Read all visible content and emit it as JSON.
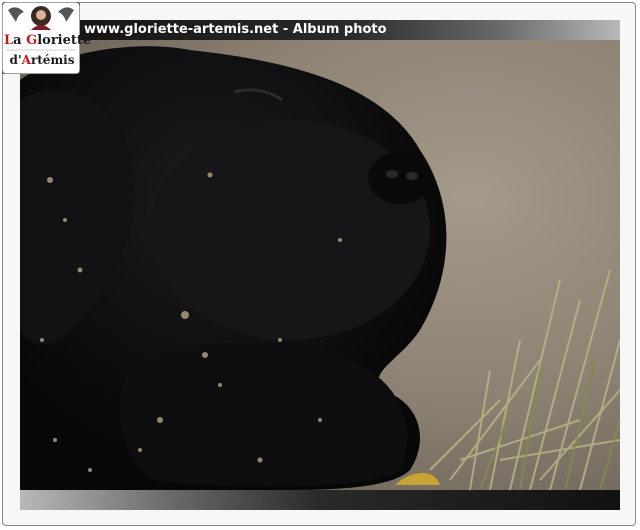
{
  "header": {
    "title": "www.gloriette-artemis.net - Album photo"
  },
  "logo": {
    "line1_cap": "L",
    "line1_rest": "a ",
    "line1_cap2": "G",
    "line1_rest2": "loriette",
    "line2_pre": "d'",
    "line2_cap": "A",
    "line2_rest": "rtémis"
  },
  "photo": {
    "subject": "black dog lying on dirt and grass"
  },
  "colors": {
    "frame_border": "#8a8a8a",
    "bar_dark": "#111111",
    "bar_light": "#b8b8b8",
    "logo_accent": "#c0181c"
  }
}
